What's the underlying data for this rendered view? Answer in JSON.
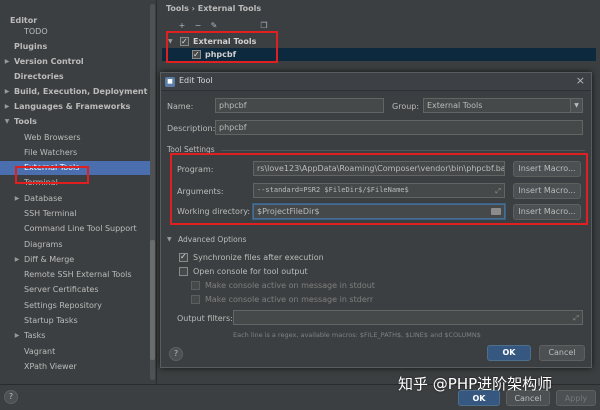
{
  "sidebar": {
    "items": [
      {
        "label": "Editor",
        "bold": true,
        "arrow": ""
      },
      {
        "label": "TODO",
        "bold": false,
        "arrow": ""
      },
      {
        "label": "Plugins",
        "bold": true,
        "arrow": ""
      },
      {
        "label": "Version Control",
        "bold": true,
        "arrow": "▶"
      },
      {
        "label": "Directories",
        "bold": true,
        "arrow": ""
      },
      {
        "label": "Build, Execution, Deployment",
        "bold": true,
        "arrow": "▶"
      },
      {
        "label": "Languages & Frameworks",
        "bold": true,
        "arrow": "▶"
      },
      {
        "label": "Tools",
        "bold": true,
        "arrow": "▼"
      },
      {
        "label": "Web Browsers",
        "bold": false,
        "arrow": ""
      },
      {
        "label": "File Watchers",
        "bold": false,
        "arrow": ""
      },
      {
        "label": "External Tools",
        "bold": false,
        "arrow": "",
        "selected": true
      },
      {
        "label": "Terminal",
        "bold": false,
        "arrow": ""
      },
      {
        "label": "Database",
        "bold": false,
        "arrow": "▶"
      },
      {
        "label": "SSH Terminal",
        "bold": false,
        "arrow": ""
      },
      {
        "label": "Command Line Tool Support",
        "bold": false,
        "arrow": ""
      },
      {
        "label": "Diagrams",
        "bold": false,
        "arrow": ""
      },
      {
        "label": "Diff & Merge",
        "bold": false,
        "arrow": "▶"
      },
      {
        "label": "Remote SSH External Tools",
        "bold": false,
        "arrow": ""
      },
      {
        "label": "Server Certificates",
        "bold": false,
        "arrow": ""
      },
      {
        "label": "Settings Repository",
        "bold": false,
        "arrow": ""
      },
      {
        "label": "Startup Tasks",
        "bold": false,
        "arrow": ""
      },
      {
        "label": "Tasks",
        "bold": false,
        "arrow": "▶"
      },
      {
        "label": "Vagrant",
        "bold": false,
        "arrow": ""
      },
      {
        "label": "XPath Viewer",
        "bold": false,
        "arrow": ""
      }
    ]
  },
  "breadcrumb": "Tools  ›  External Tools",
  "toolbar": {
    "icons": [
      "add-icon",
      "remove-icon",
      "edit-icon",
      "copy-icon"
    ],
    "glyphs": [
      "+",
      "−",
      "✎",
      "❐"
    ]
  },
  "tree": {
    "group": "External Tools",
    "group_arrow": "▼",
    "tool": "phpcbf"
  },
  "dialog": {
    "title": "Edit Tool",
    "name_label": "Name:",
    "name_value": "phpcbf",
    "group_label": "Group:",
    "group_value": "External Tools",
    "description_label": "Description:",
    "description_value": "phpcbf",
    "tool_settings_label": "Tool Settings",
    "program_label": "Program:",
    "program_value": "rs\\love123\\AppData\\Roaming\\Composer\\vendor\\bin\\phpcbf.bat",
    "arguments_label": "Arguments:",
    "arguments_value": "--standard=PSR2 $FileDir$/$FileName$",
    "workdir_label": "Working directory:",
    "workdir_value": "$ProjectFileDir$",
    "insert_macro": "Insert Macro...",
    "advanced_label": "Advanced Options",
    "advanced_arrow": "▼",
    "sync_files": "Synchronize files after execution",
    "open_console": "Open console for tool output",
    "console_stdout": "Make console active on message in stdout",
    "console_stderr": "Make console active on message in stderr",
    "output_filters_label": "Output filters:",
    "hint": "Each line is a regex, available macros: $FILE_PATH$, $LINE$ and $COLUMN$",
    "ok": "OK",
    "cancel": "Cancel",
    "help": "?"
  },
  "bottom_bar": {
    "help": "?",
    "ok": "OK",
    "cancel": "Cancel",
    "apply": "Apply"
  },
  "watermark": "知乎 @PHP进阶架构师",
  "colors": {
    "background": "#3c3f41",
    "selection": "#4b6eaf",
    "highlight": "#e02020",
    "primary_button": "#365880"
  }
}
